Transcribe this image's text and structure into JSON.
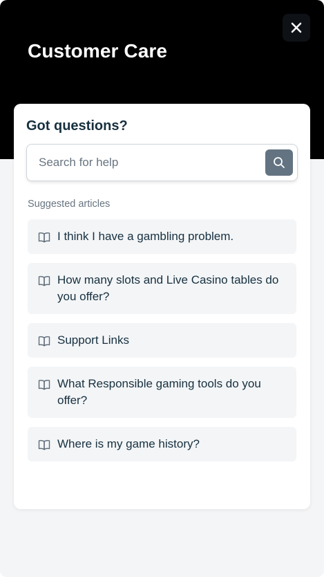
{
  "header": {
    "title": "Customer Care",
    "close_icon": "close-icon"
  },
  "card": {
    "title": "Got questions?",
    "search": {
      "placeholder": "Search for help",
      "value": "",
      "button_icon": "search-icon"
    },
    "suggested_label": "Suggested articles",
    "articles": [
      {
        "label": "I think I have a gambling problem.",
        "icon": "book-icon"
      },
      {
        "label": "How many slots and Live Casino tables do you offer?",
        "icon": "book-icon"
      },
      {
        "label": "Support Links",
        "icon": "book-icon"
      },
      {
        "label": "What Responsible gaming tools do you offer?",
        "icon": "book-icon"
      },
      {
        "label": "Where is my game history?",
        "icon": "book-icon"
      }
    ]
  },
  "colors": {
    "header_bg": "#000000",
    "text_primary": "#17303f",
    "text_muted": "#687480",
    "search_button": "#637381",
    "article_bg": "#f3f5f7"
  }
}
